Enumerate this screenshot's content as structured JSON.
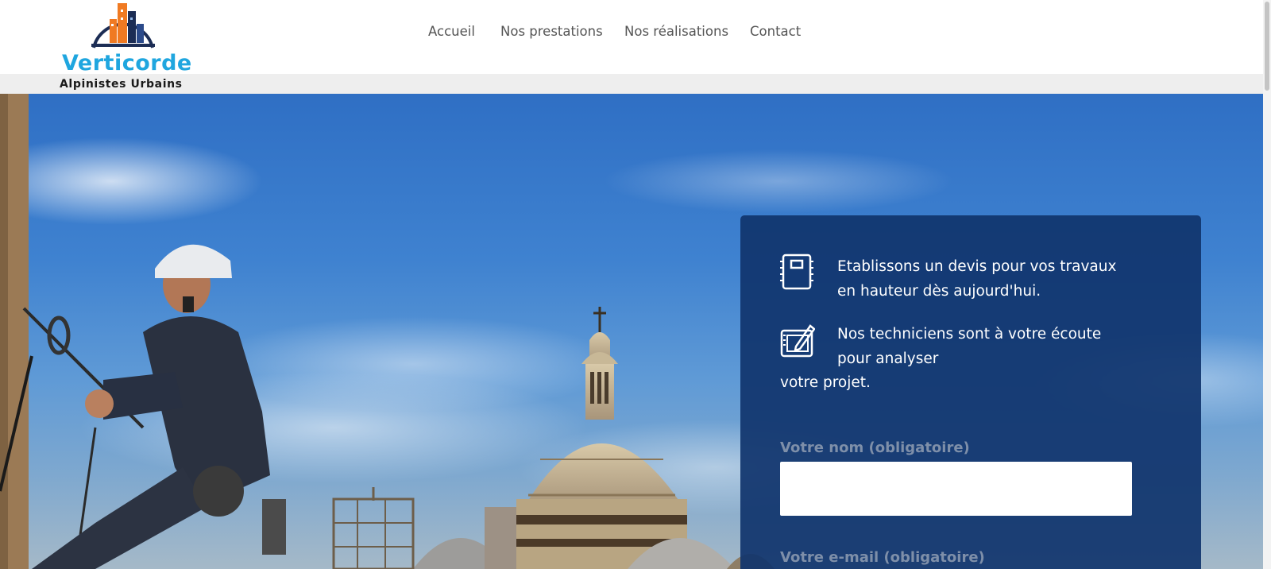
{
  "brand": {
    "name": "Verticorde",
    "tagline": "Alpinistes Urbains",
    "colors": {
      "accent": "#1fa6df",
      "orange": "#f07a22",
      "navy": "#1c2d55"
    }
  },
  "nav": {
    "items": [
      {
        "label": "Accueil"
      },
      {
        "label": "Nos prestations"
      },
      {
        "label": "Nos réalisations"
      },
      {
        "label": "Contact"
      }
    ]
  },
  "panel": {
    "item1_icon": "notebook-icon",
    "item1_text": "Etablissons un devis pour vos travaux en hauteur dès aujourd'hui.",
    "item2_icon": "drawing-tablet-icon",
    "item2_text_line": "Nos techniciens sont à votre écoute pour analyser",
    "item2_text_tail": "votre projet.",
    "name_label": "Votre nom (obligatoire)",
    "name_value": "",
    "email_label": "Votre e-mail (obligatoire)"
  },
  "colors": {
    "panel_bg": "#10346c",
    "sky": "#3f82d0"
  }
}
